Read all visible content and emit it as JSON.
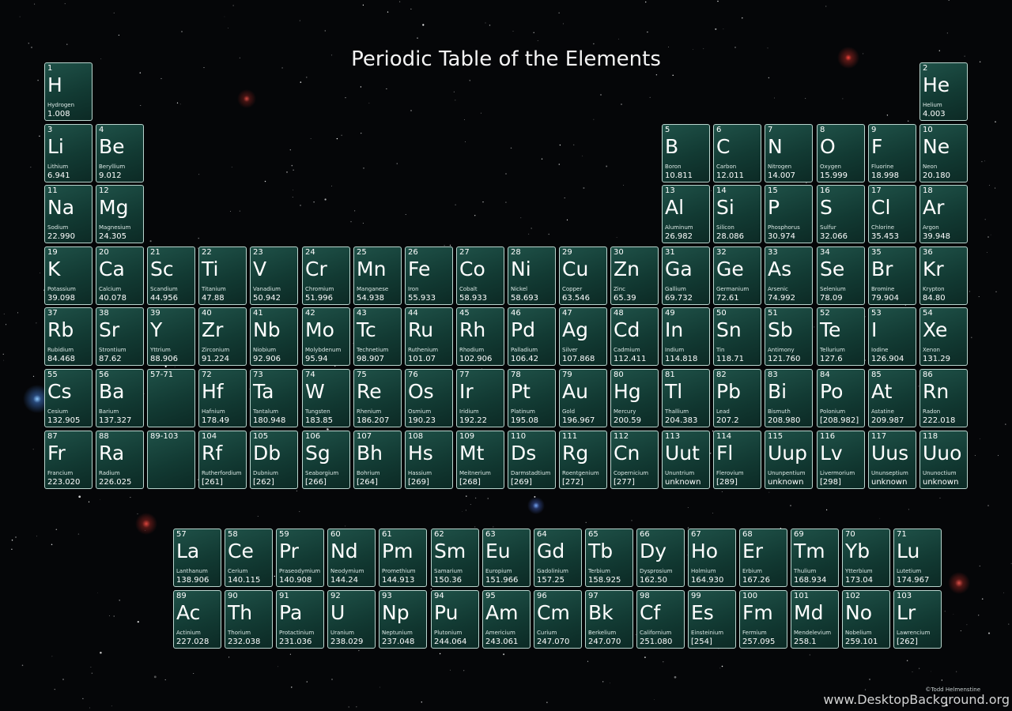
{
  "title": "Periodic Table of the Elements",
  "credit": "©Todd Helmenstine",
  "watermark": "www.DesktopBackground.org",
  "colors": {
    "tile": "#123a33",
    "tile_border": "#b8d4cd",
    "text": "#ffffff"
  },
  "main_table": [
    [
      [
        "1",
        "H",
        "Hydrogen",
        "1.008"
      ],
      null,
      null,
      null,
      null,
      null,
      null,
      null,
      null,
      null,
      null,
      null,
      null,
      null,
      null,
      null,
      null,
      [
        "2",
        "He",
        "Helium",
        "4.003"
      ]
    ],
    [
      [
        "3",
        "Li",
        "Lithium",
        "6.941"
      ],
      [
        "4",
        "Be",
        "Beryllium",
        "9.012"
      ],
      null,
      null,
      null,
      null,
      null,
      null,
      null,
      null,
      null,
      null,
      [
        "5",
        "B",
        "Boron",
        "10.811"
      ],
      [
        "6",
        "C",
        "Carbon",
        "12.011"
      ],
      [
        "7",
        "N",
        "Nitrogen",
        "14.007"
      ],
      [
        "8",
        "O",
        "Oxygen",
        "15.999"
      ],
      [
        "9",
        "F",
        "Fluorine",
        "18.998"
      ],
      [
        "10",
        "Ne",
        "Neon",
        "20.180"
      ]
    ],
    [
      [
        "11",
        "Na",
        "Sodium",
        "22.990"
      ],
      [
        "12",
        "Mg",
        "Magnesium",
        "24.305"
      ],
      null,
      null,
      null,
      null,
      null,
      null,
      null,
      null,
      null,
      null,
      [
        "13",
        "Al",
        "Aluminum",
        "26.982"
      ],
      [
        "14",
        "Si",
        "Silicon",
        "28.086"
      ],
      [
        "15",
        "P",
        "Phosphorus",
        "30.974"
      ],
      [
        "16",
        "S",
        "Sulfur",
        "32.066"
      ],
      [
        "17",
        "Cl",
        "Chlorine",
        "35.453"
      ],
      [
        "18",
        "Ar",
        "Argon",
        "39.948"
      ]
    ],
    [
      [
        "19",
        "K",
        "Potassium",
        "39.098"
      ],
      [
        "20",
        "Ca",
        "Calcium",
        "40.078"
      ],
      [
        "21",
        "Sc",
        "Scandium",
        "44.956"
      ],
      [
        "22",
        "Ti",
        "Titanium",
        "47.88"
      ],
      [
        "23",
        "V",
        "Vanadium",
        "50.942"
      ],
      [
        "24",
        "Cr",
        "Chromium",
        "51.996"
      ],
      [
        "25",
        "Mn",
        "Manganese",
        "54.938"
      ],
      [
        "26",
        "Fe",
        "Iron",
        "55.933"
      ],
      [
        "27",
        "Co",
        "Cobalt",
        "58.933"
      ],
      [
        "28",
        "Ni",
        "Nickel",
        "58.693"
      ],
      [
        "29",
        "Cu",
        "Copper",
        "63.546"
      ],
      [
        "30",
        "Zn",
        "Zinc",
        "65.39"
      ],
      [
        "31",
        "Ga",
        "Gallium",
        "69.732"
      ],
      [
        "32",
        "Ge",
        "Germanium",
        "72.61"
      ],
      [
        "33",
        "As",
        "Arsenic",
        "74.992"
      ],
      [
        "34",
        "Se",
        "Selenium",
        "78.09"
      ],
      [
        "35",
        "Br",
        "Bromine",
        "79.904"
      ],
      [
        "36",
        "Kr",
        "Krypton",
        "84.80"
      ]
    ],
    [
      [
        "37",
        "Rb",
        "Rubidium",
        "84.468"
      ],
      [
        "38",
        "Sr",
        "Strontium",
        "87.62"
      ],
      [
        "39",
        "Y",
        "Yttrium",
        "88.906"
      ],
      [
        "40",
        "Zr",
        "Zirconium",
        "91.224"
      ],
      [
        "41",
        "Nb",
        "Niobium",
        "92.906"
      ],
      [
        "42",
        "Mo",
        "Molybdenum",
        "95.94"
      ],
      [
        "43",
        "Tc",
        "Technetium",
        "98.907"
      ],
      [
        "44",
        "Ru",
        "Ruthenium",
        "101.07"
      ],
      [
        "45",
        "Rh",
        "Rhodium",
        "102.906"
      ],
      [
        "46",
        "Pd",
        "Palladium",
        "106.42"
      ],
      [
        "47",
        "Ag",
        "Silver",
        "107.868"
      ],
      [
        "48",
        "Cd",
        "Cadmium",
        "112.411"
      ],
      [
        "49",
        "In",
        "Indium",
        "114.818"
      ],
      [
        "50",
        "Sn",
        "Tin",
        "118.71"
      ],
      [
        "51",
        "Sb",
        "Antimony",
        "121.760"
      ],
      [
        "52",
        "Te",
        "Tellurium",
        "127.6"
      ],
      [
        "53",
        "I",
        "Iodine",
        "126.904"
      ],
      [
        "54",
        "Xe",
        "Xenon",
        "131.29"
      ]
    ],
    [
      [
        "55",
        "Cs",
        "Cesium",
        "132.905"
      ],
      [
        "56",
        "Ba",
        "Barium",
        "137.327"
      ],
      [
        "57-71",
        "",
        "",
        ""
      ],
      [
        "72",
        "Hf",
        "Hafnium",
        "178.49"
      ],
      [
        "73",
        "Ta",
        "Tantalum",
        "180.948"
      ],
      [
        "74",
        "W",
        "Tungsten",
        "183.85"
      ],
      [
        "75",
        "Re",
        "Rhenium",
        "186.207"
      ],
      [
        "76",
        "Os",
        "Osmium",
        "190.23"
      ],
      [
        "77",
        "Ir",
        "Iridium",
        "192.22"
      ],
      [
        "78",
        "Pt",
        "Platinum",
        "195.08"
      ],
      [
        "79",
        "Au",
        "Gold",
        "196.967"
      ],
      [
        "80",
        "Hg",
        "Mercury",
        "200.59"
      ],
      [
        "81",
        "Tl",
        "Thallium",
        "204.383"
      ],
      [
        "82",
        "Pb",
        "Lead",
        "207.2"
      ],
      [
        "83",
        "Bi",
        "Bismuth",
        "208.980"
      ],
      [
        "84",
        "Po",
        "Polonium",
        "[208.982]"
      ],
      [
        "85",
        "At",
        "Astatine",
        "209.987"
      ],
      [
        "86",
        "Rn",
        "Radon",
        "222.018"
      ]
    ],
    [
      [
        "87",
        "Fr",
        "Francium",
        "223.020"
      ],
      [
        "88",
        "Ra",
        "Radium",
        "226.025"
      ],
      [
        "89-103",
        "",
        "",
        ""
      ],
      [
        "104",
        "Rf",
        "Rutherfordium",
        "[261]"
      ],
      [
        "105",
        "Db",
        "Dubnium",
        "[262]"
      ],
      [
        "106",
        "Sg",
        "Seaborgium",
        "[266]"
      ],
      [
        "107",
        "Bh",
        "Bohrium",
        "[264]"
      ],
      [
        "108",
        "Hs",
        "Hassium",
        "[269]"
      ],
      [
        "109",
        "Mt",
        "Meitnerium",
        "[268]"
      ],
      [
        "110",
        "Ds",
        "Darmstadtium",
        "[269]"
      ],
      [
        "111",
        "Rg",
        "Roentgenium",
        "[272]"
      ],
      [
        "112",
        "Cn",
        "Copernicium",
        "[277]"
      ],
      [
        "113",
        "Uut",
        "Ununtrium",
        "unknown"
      ],
      [
        "114",
        "Fl",
        "Flerovium",
        "[289]"
      ],
      [
        "115",
        "Uup",
        "Ununpentium",
        "unknown"
      ],
      [
        "116",
        "Lv",
        "Livermorium",
        "[298]"
      ],
      [
        "117",
        "Uus",
        "Ununseptium",
        "unknown"
      ],
      [
        "118",
        "Uuo",
        "Ununoctium",
        "unknown"
      ]
    ]
  ],
  "f_block": [
    [
      [
        "57",
        "La",
        "Lanthanum",
        "138.906"
      ],
      [
        "58",
        "Ce",
        "Cerium",
        "140.115"
      ],
      [
        "59",
        "Pr",
        "Praseodymium",
        "140.908"
      ],
      [
        "60",
        "Nd",
        "Neodymium",
        "144.24"
      ],
      [
        "61",
        "Pm",
        "Promethium",
        "144.913"
      ],
      [
        "62",
        "Sm",
        "Samarium",
        "150.36"
      ],
      [
        "63",
        "Eu",
        "Europium",
        "151.966"
      ],
      [
        "64",
        "Gd",
        "Gadolinium",
        "157.25"
      ],
      [
        "65",
        "Tb",
        "Terbium",
        "158.925"
      ],
      [
        "66",
        "Dy",
        "Dysprosium",
        "162.50"
      ],
      [
        "67",
        "Ho",
        "Holmium",
        "164.930"
      ],
      [
        "68",
        "Er",
        "Erbium",
        "167.26"
      ],
      [
        "69",
        "Tm",
        "Thulium",
        "168.934"
      ],
      [
        "70",
        "Yb",
        "Ytterbium",
        "173.04"
      ],
      [
        "71",
        "Lu",
        "Lutetium",
        "174.967"
      ]
    ],
    [
      [
        "89",
        "Ac",
        "Actinium",
        "227.028"
      ],
      [
        "90",
        "Th",
        "Thorium",
        "232.038"
      ],
      [
        "91",
        "Pa",
        "Protactinium",
        "231.036"
      ],
      [
        "92",
        "U",
        "Uranium",
        "238.029"
      ],
      [
        "93",
        "Np",
        "Neptunium",
        "237.048"
      ],
      [
        "94",
        "Pu",
        "Plutonium",
        "244.064"
      ],
      [
        "95",
        "Am",
        "Americium",
        "243.061"
      ],
      [
        "96",
        "Cm",
        "Curium",
        "247.070"
      ],
      [
        "97",
        "Bk",
        "Berkelium",
        "247.070"
      ],
      [
        "98",
        "Cf",
        "Californium",
        "251.080"
      ],
      [
        "99",
        "Es",
        "Einsteinium",
        "[254]"
      ],
      [
        "100",
        "Fm",
        "Fermium",
        "257.095"
      ],
      [
        "101",
        "Md",
        "Mendelevium",
        "258.1"
      ],
      [
        "102",
        "No",
        "Nobelium",
        "259.101"
      ],
      [
        "103",
        "Lr",
        "Lawrencium",
        "[262]"
      ]
    ]
  ]
}
